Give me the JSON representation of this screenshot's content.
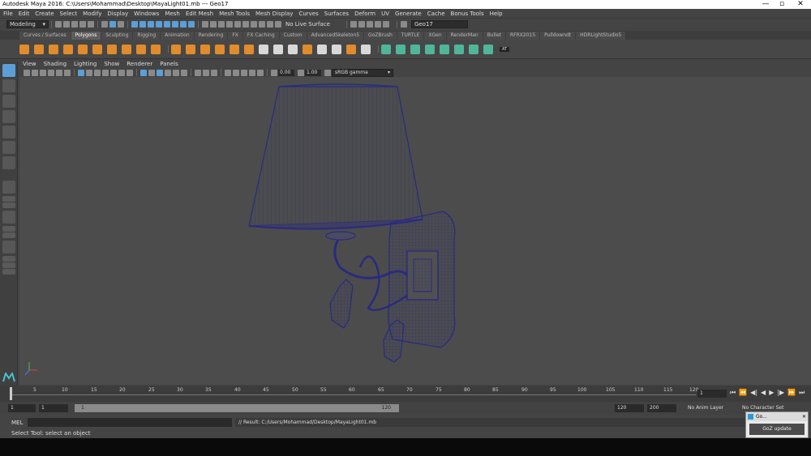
{
  "window": {
    "title": "Autodesk Maya 2016: C:\\Users\\Mohammad\\Desktop\\MayaLight01.mb  ---  Geo17",
    "minimize": "—",
    "maximize": "▫",
    "close": "✕"
  },
  "menubar": [
    "File",
    "Edit",
    "Create",
    "Select",
    "Modify",
    "Display",
    "Windows",
    "Mesh",
    "Edit Mesh",
    "Mesh Tools",
    "Mesh Display",
    "Curves",
    "Surfaces",
    "Deform",
    "UV",
    "Generate",
    "Cache",
    "Bonus Tools",
    "Help"
  ],
  "statusline": {
    "mode": "Modeling",
    "live_surface": "No Live Surface",
    "object_field": "Geo17"
  },
  "shelf_tabs": [
    "Curves / Surfaces",
    "Polygons",
    "Sculpting",
    "Rigging",
    "Animation",
    "Rendering",
    "FX",
    "FX Caching",
    "Custom",
    "AdvancedSkeleton5",
    "GoZBrush",
    "TURTLE",
    "XGen",
    "RenderMan",
    "Bullet",
    "RFRX2015",
    "Pulldowndt",
    "HDRLightStudio5"
  ],
  "active_shelf_tab": "Polygons",
  "shelf_badge": "AT",
  "panel_menu": [
    "View",
    "Shading",
    "Lighting",
    "Show",
    "Renderer",
    "Panels"
  ],
  "panel_toolbar": {
    "exposure": "0.00",
    "gamma": "1.00",
    "color_space": "sRGB gamma"
  },
  "timeline": {
    "ticks": [
      "1",
      "5",
      "10",
      "15",
      "20",
      "25",
      "30",
      "35",
      "40",
      "45",
      "50",
      "55",
      "60",
      "65",
      "70",
      "75",
      "80",
      "85",
      "90",
      "95",
      "100",
      "105",
      "110",
      "115",
      "120"
    ],
    "current_frame": "1",
    "playback_buttons": [
      "⏮",
      "⏪",
      "◀|",
      "◀",
      "▶",
      "|▶",
      "⏩",
      "⏭"
    ]
  },
  "range": {
    "start": "1",
    "anim_start": "1",
    "slider_start": "1",
    "slider_end": "120",
    "anim_end": "120",
    "end": "200",
    "anim_layer": "No Anim Layer",
    "character_set": "No Character Set"
  },
  "command": {
    "label": "MEL",
    "result": "// Result: C:/Users/Mohammad/Desktop/MayaLight01.mb"
  },
  "helpline": "Select Tool: select an object",
  "goz": {
    "title": "Go...",
    "button": "GoZ update"
  },
  "colors": {
    "orange_icon": "#e08b2c",
    "teal_icon": "#4fb69a",
    "selection_blue": "#5b9fd6",
    "wireframe": "#2d2d8a"
  }
}
